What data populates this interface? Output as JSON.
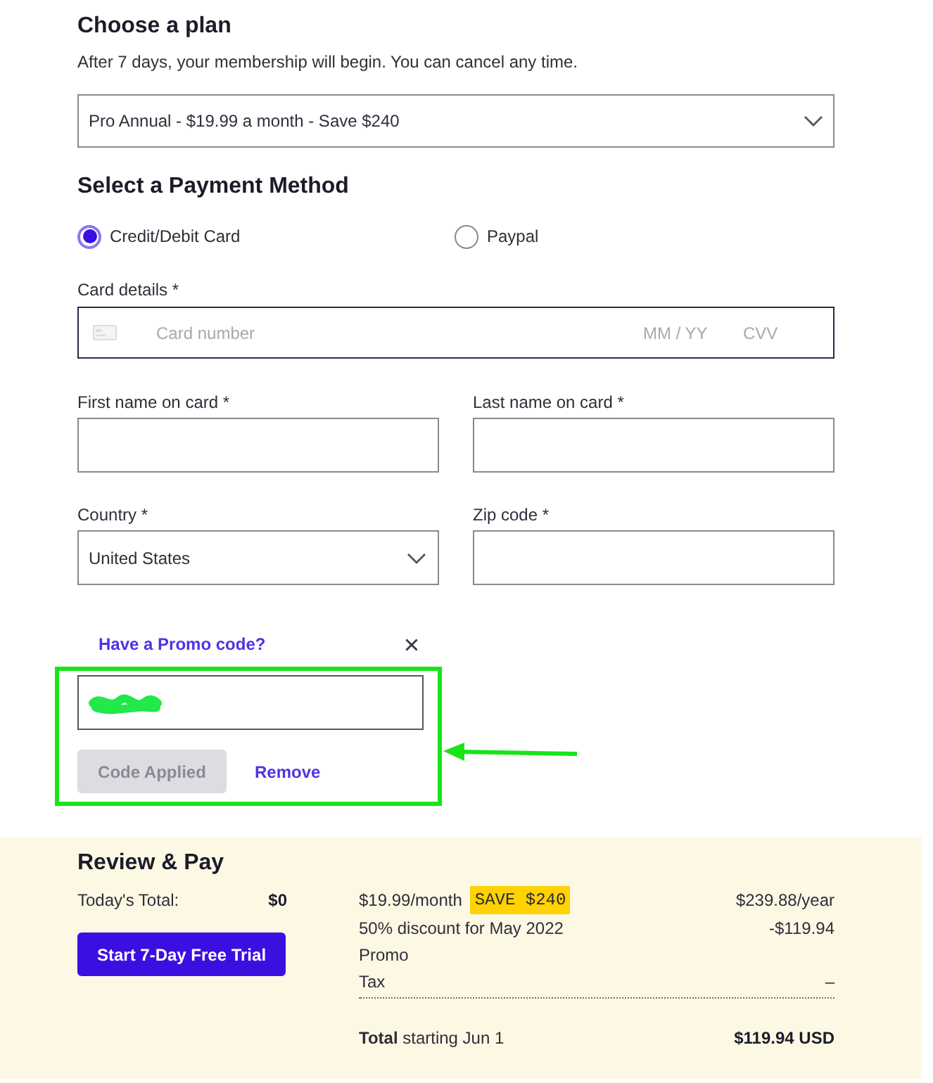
{
  "plan": {
    "title": "Choose a plan",
    "subtitle": "After 7 days, your membership will begin. You can cancel any time.",
    "select": {
      "value": "Pro Annual - $19.99 a month - Save $240"
    }
  },
  "payment": {
    "title": "Select a Payment Method",
    "methods": [
      {
        "label": "Credit/Debit Card",
        "selected": true
      },
      {
        "label": "Paypal",
        "selected": false
      }
    ],
    "card": {
      "label": "Card details *",
      "focused": true,
      "number_placeholder": "Card number",
      "expiry_placeholder": "MM / YY",
      "cvv_placeholder": "CVV"
    },
    "fields": [
      {
        "kind": "text",
        "label": "First name on card *"
      },
      {
        "kind": "text",
        "label": "Last name on card *"
      },
      {
        "kind": "select",
        "label": "Country *",
        "value": "United States"
      },
      {
        "kind": "text",
        "label": "Zip code *"
      }
    ]
  },
  "promo": {
    "title": "Have a Promo code?",
    "redacted": true,
    "apply_button": {
      "label": "Code Applied",
      "disabled": true
    },
    "remove_link": "Remove"
  },
  "review": {
    "title": "Review & Pay",
    "today_label": "Today's Total:",
    "today_value": "$0",
    "button": "Start 7-Day Free Trial",
    "lines": [
      {
        "label": "$19.99/month",
        "badge": "SAVE $240",
        "amount": "$239.88/year"
      },
      {
        "label": "50% discount for May 2022",
        "amount": "-$119.94"
      },
      {
        "label": "Promo"
      },
      {
        "label": "Tax",
        "amount": "–"
      }
    ],
    "total": {
      "label": "**Total** starting Jun 1",
      "amount": "$119.94 USD"
    }
  }
}
